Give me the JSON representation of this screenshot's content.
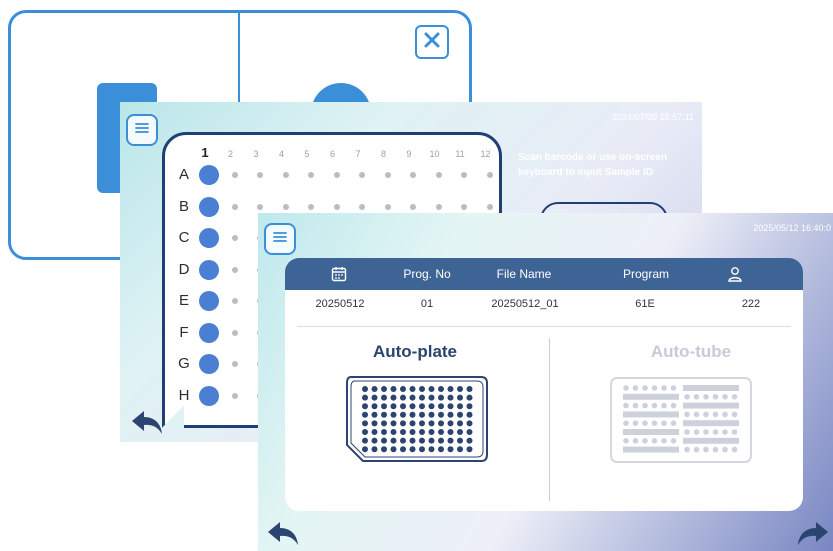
{
  "screen1": {
    "close_icon": "close-x-icon"
  },
  "screen2": {
    "timestamp": "2024/07/09 15:57:11",
    "menu_icon": "hamburger-menu-icon",
    "columns": [
      "1",
      "2",
      "3",
      "4",
      "5",
      "6",
      "7",
      "8",
      "9",
      "10",
      "11",
      "12"
    ],
    "rows": [
      "A",
      "B",
      "C",
      "D",
      "E",
      "F",
      "G",
      "H"
    ],
    "instruction": "Scan barcode or use on-screen keyboard to input Sample ID",
    "back_icon": "back-arrow-icon"
  },
  "screen3": {
    "timestamp": "2025/05/12 16:40:0",
    "menu_icon": "hamburger-menu-icon",
    "table": {
      "headers": {
        "date_icon": "calendar-icon",
        "prog_no": "Prog. No",
        "file_name": "File Name",
        "program": "Program",
        "user_icon": "user-icon"
      },
      "row": {
        "date": "20250512",
        "prog_no": "01",
        "file_name": "20250512_01",
        "program": "61E",
        "user": "222"
      }
    },
    "modes": {
      "plate": "Auto-plate",
      "tube": "Auto-tube"
    },
    "back_icon": "back-arrow-icon",
    "forward_icon": "forward-arrow-icon"
  },
  "colors": {
    "accent": "#3b8fd9",
    "header": "#3e6496",
    "navy": "#1f3f75",
    "well": "#4a7fd3",
    "disabled": "#c6cbd7"
  }
}
